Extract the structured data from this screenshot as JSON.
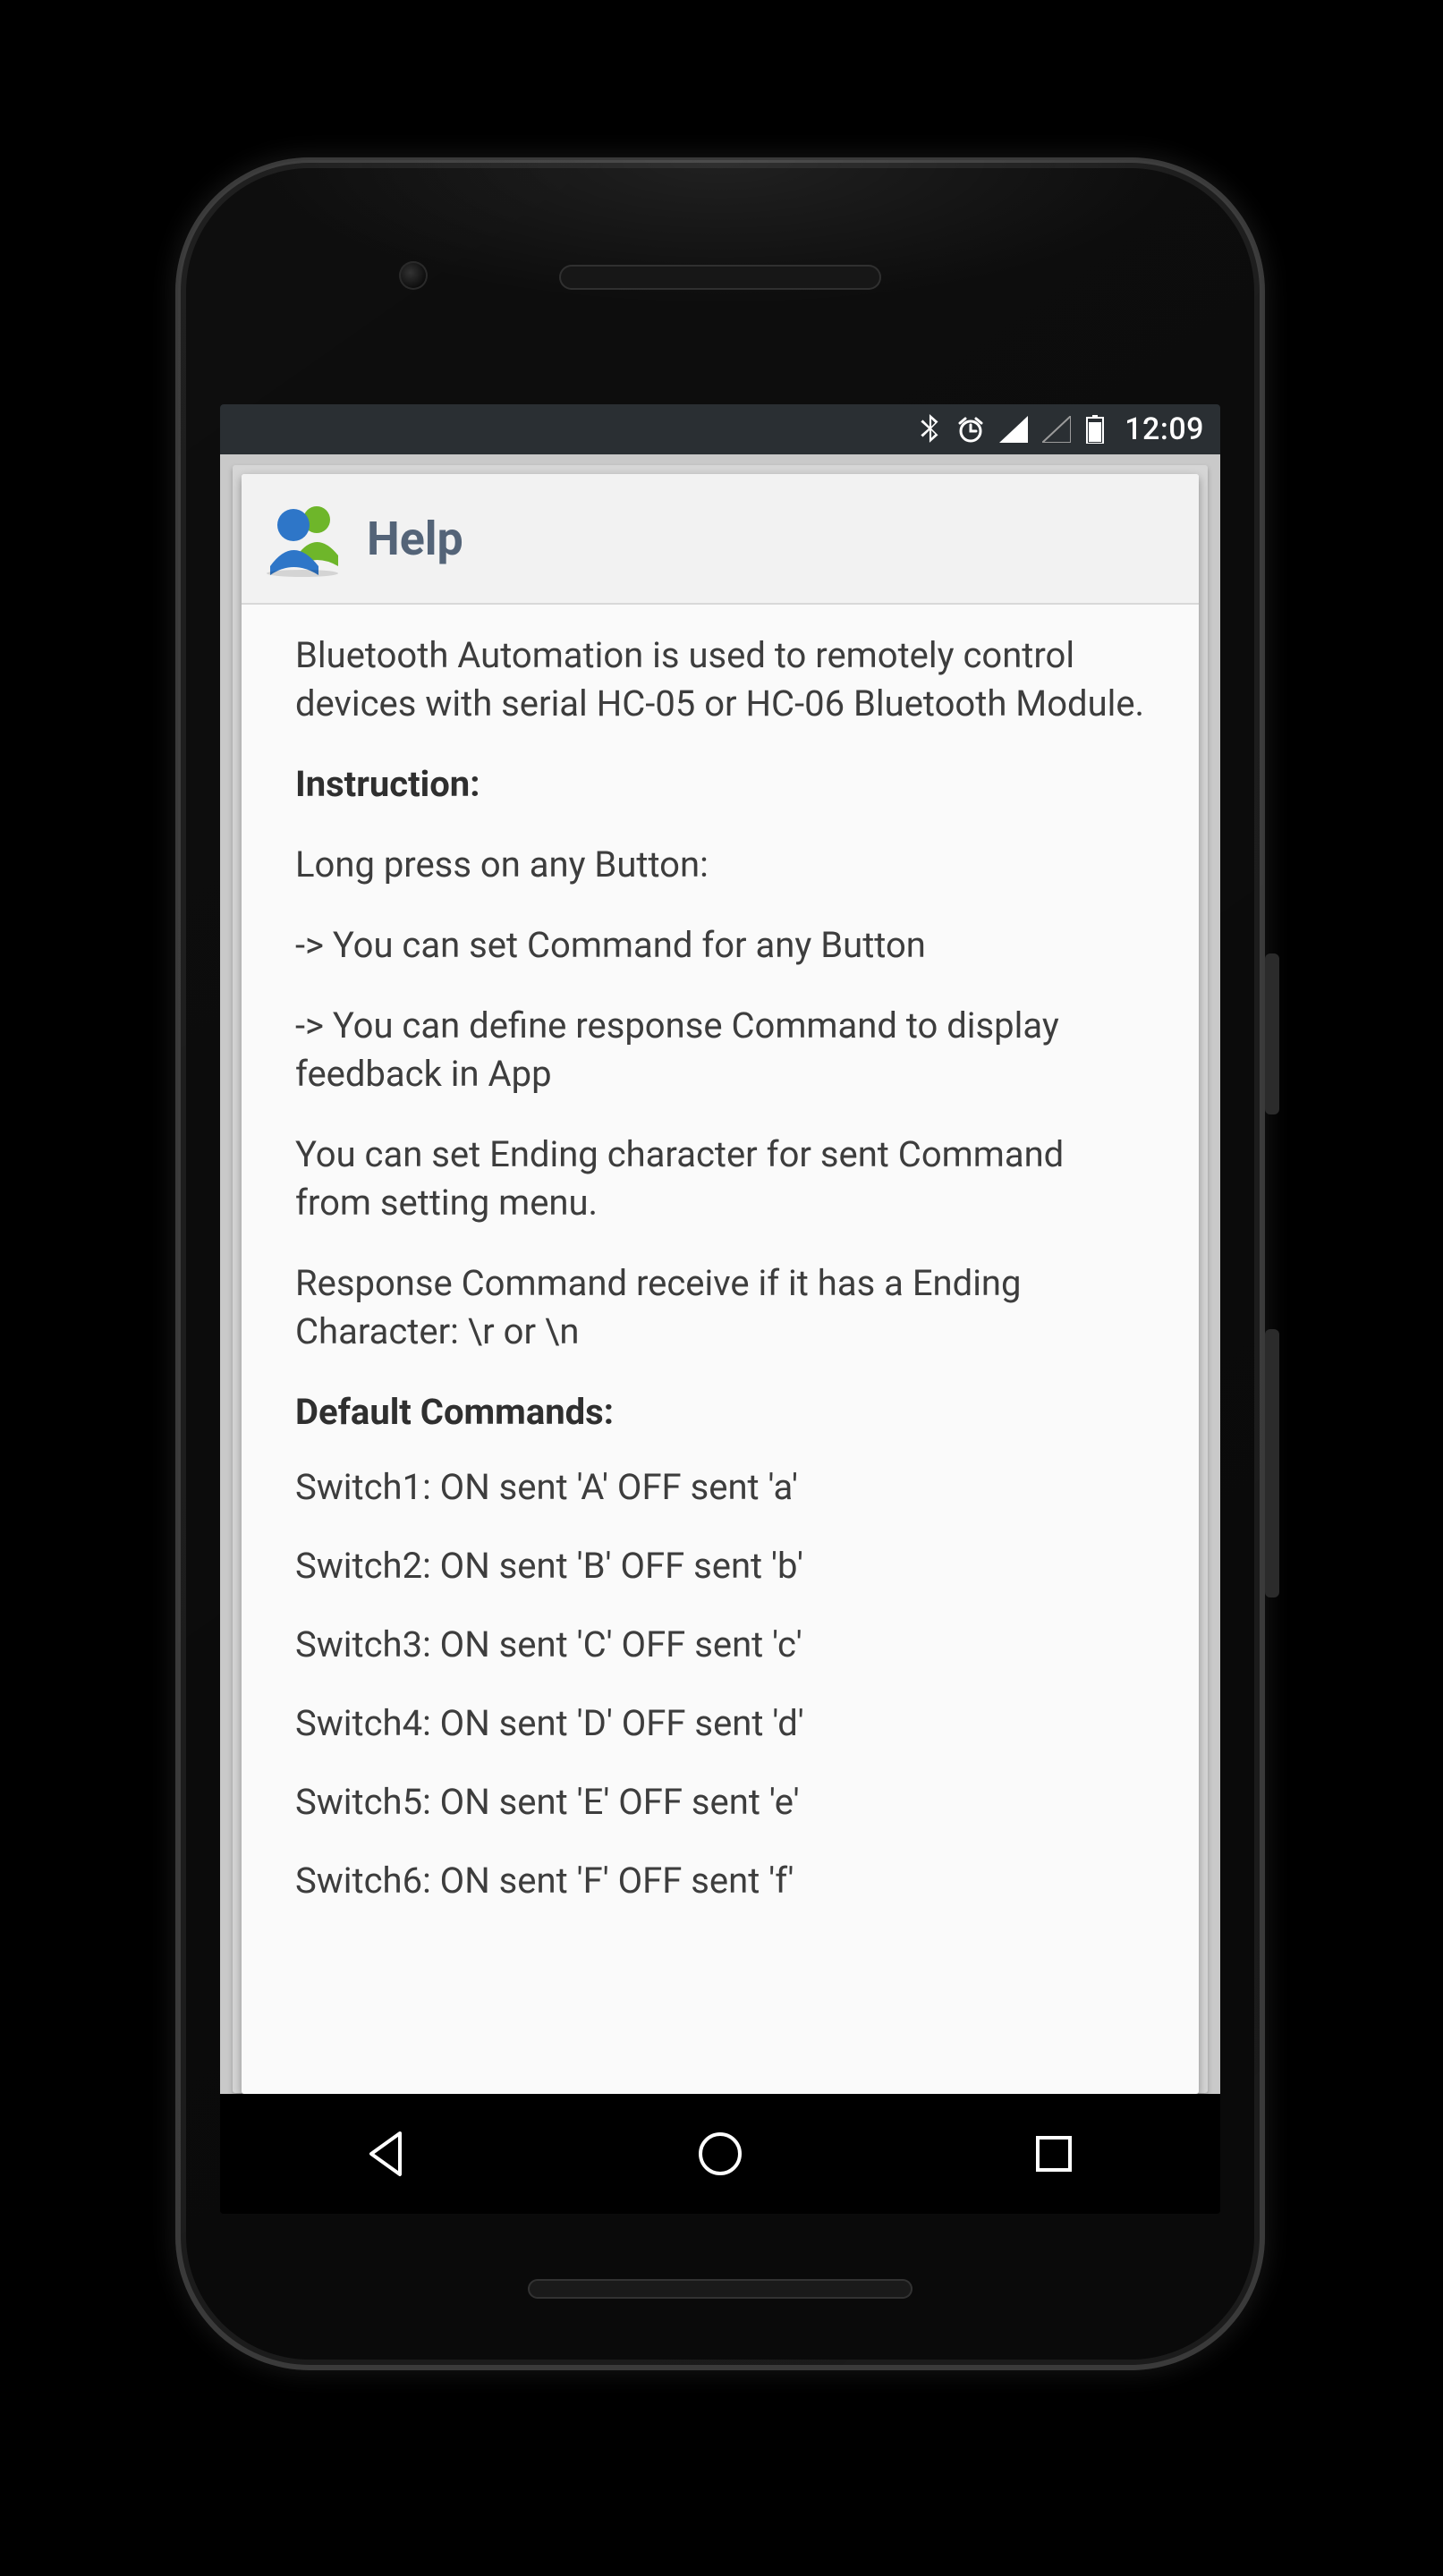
{
  "status_bar": {
    "icons": {
      "bluetooth": "bluetooth-icon",
      "alarm": "alarm-clock-icon",
      "signal_full": "cell-signal-full-icon",
      "signal_empty": "cell-signal-empty-icon",
      "battery": "battery-icon"
    },
    "time": "12:09"
  },
  "card": {
    "title": "Help",
    "icon": "people-icon"
  },
  "content": {
    "intro": "Bluetooth Automation is used to remotely control devices with serial HC-05 or HC-06 Bluetooth Module.",
    "instruction_heading": "Instruction:",
    "longpress": "Long press on any Button:",
    "set_command": "-> You can set Command for any Button",
    "response_command": "-> You can define response Command to display feedback in App",
    "ending_char": "You can set Ending character for sent Command from setting menu.",
    "response_receive": "Response Command receive if it has a Ending Character: \\r or \\n",
    "default_heading": "Default Commands:",
    "switches": {
      "s1": "Switch1: ON sent 'A' OFF sent 'a'",
      "s2": "Switch2: ON sent 'B' OFF sent 'b'",
      "s3": "Switch3: ON sent 'C' OFF sent 'c'",
      "s4": "Switch4: ON sent 'D' OFF sent 'd'",
      "s5": "Switch5: ON sent 'E' OFF sent 'e'",
      "s6": "Switch6: ON sent 'F' OFF sent 'f'"
    }
  },
  "nav": {
    "back": "nav-back",
    "home": "nav-home",
    "recents": "nav-recents"
  }
}
